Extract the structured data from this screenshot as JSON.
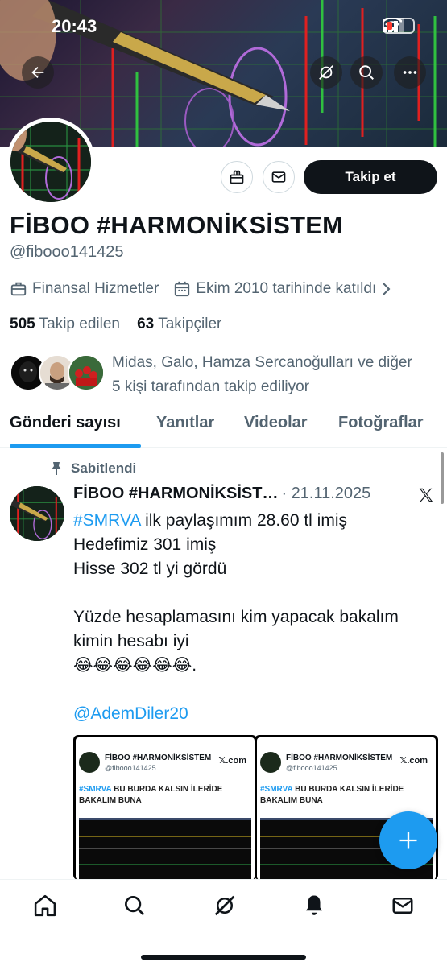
{
  "status_bar": {
    "time": "20:43"
  },
  "profile": {
    "name": "FİBOO #HARMONİKSİSTEM",
    "handle": "@fibooo141425",
    "category": "Finansal Hizmetler",
    "joined": "Ekim 2010 tarihinde katıldı",
    "following_count": "505",
    "following_label": "Takip edilen",
    "followers_count": "63",
    "followers_label": "Takipçiler",
    "followed_by_line1": "Midas, Galo, Hamza Sercanoğulları ve diğer",
    "followed_by_line2": "5 kişi tarafından takip ediliyor",
    "follow_button": "Takip et"
  },
  "tabs": [
    {
      "label": "Gönderi sayısı",
      "active": true
    },
    {
      "label": "Yanıtlar",
      "active": false
    },
    {
      "label": "Videolar",
      "active": false
    },
    {
      "label": "Fotoğraflar",
      "active": false
    }
  ],
  "post": {
    "pinned_label": "Sabitlendi",
    "author_name": "FİBOO #HARMONİKSİST…",
    "date": "· 21.11.2025",
    "hashtag": "#SMRVA",
    "line1_rest": " ilk paylaşımım 28.60 tl imiş",
    "line2": "Hedefimiz 301 imiş",
    "line3": "Hisse 302 tl yi gördü",
    "line4": "Yüzde hesaplamasını kim yapacak bakalım",
    "line5": "kimin hesabı iyi",
    "line6": "😂😂😂😂😂😂.",
    "mention": "@AdemDiler20",
    "media_cards": [
      {
        "name": "FİBOO #HARMONİKSİSTEM",
        "handle": "@fibooo141425",
        "site": "𝕏.com",
        "hashtag": "#SMRVA",
        "text_rest": " BU BURDA KALSIN İLERİDE BAKALIM BUNA"
      },
      {
        "name": "FİBOO #HARMONİKSİSTEM",
        "handle": "@fibooo141425",
        "site": "𝕏.com",
        "hashtag": "#SMRVA",
        "text_rest": " BU BURDA KALSIN İLERİDE BAKALIM BUNA"
      }
    ]
  },
  "colors": {
    "accent": "#1d9bf0",
    "text": "#0f1419",
    "secondary": "#536471"
  },
  "icons": [
    "back-icon",
    "grok-icon",
    "search-icon",
    "more-icon",
    "gift-icon",
    "message-icon",
    "briefcase-icon",
    "calendar-icon",
    "chevron-right-icon",
    "pin-icon",
    "x-logo-icon",
    "plus-icon",
    "home-icon",
    "explore-icon",
    "grok-icon",
    "bell-icon",
    "mail-icon"
  ]
}
